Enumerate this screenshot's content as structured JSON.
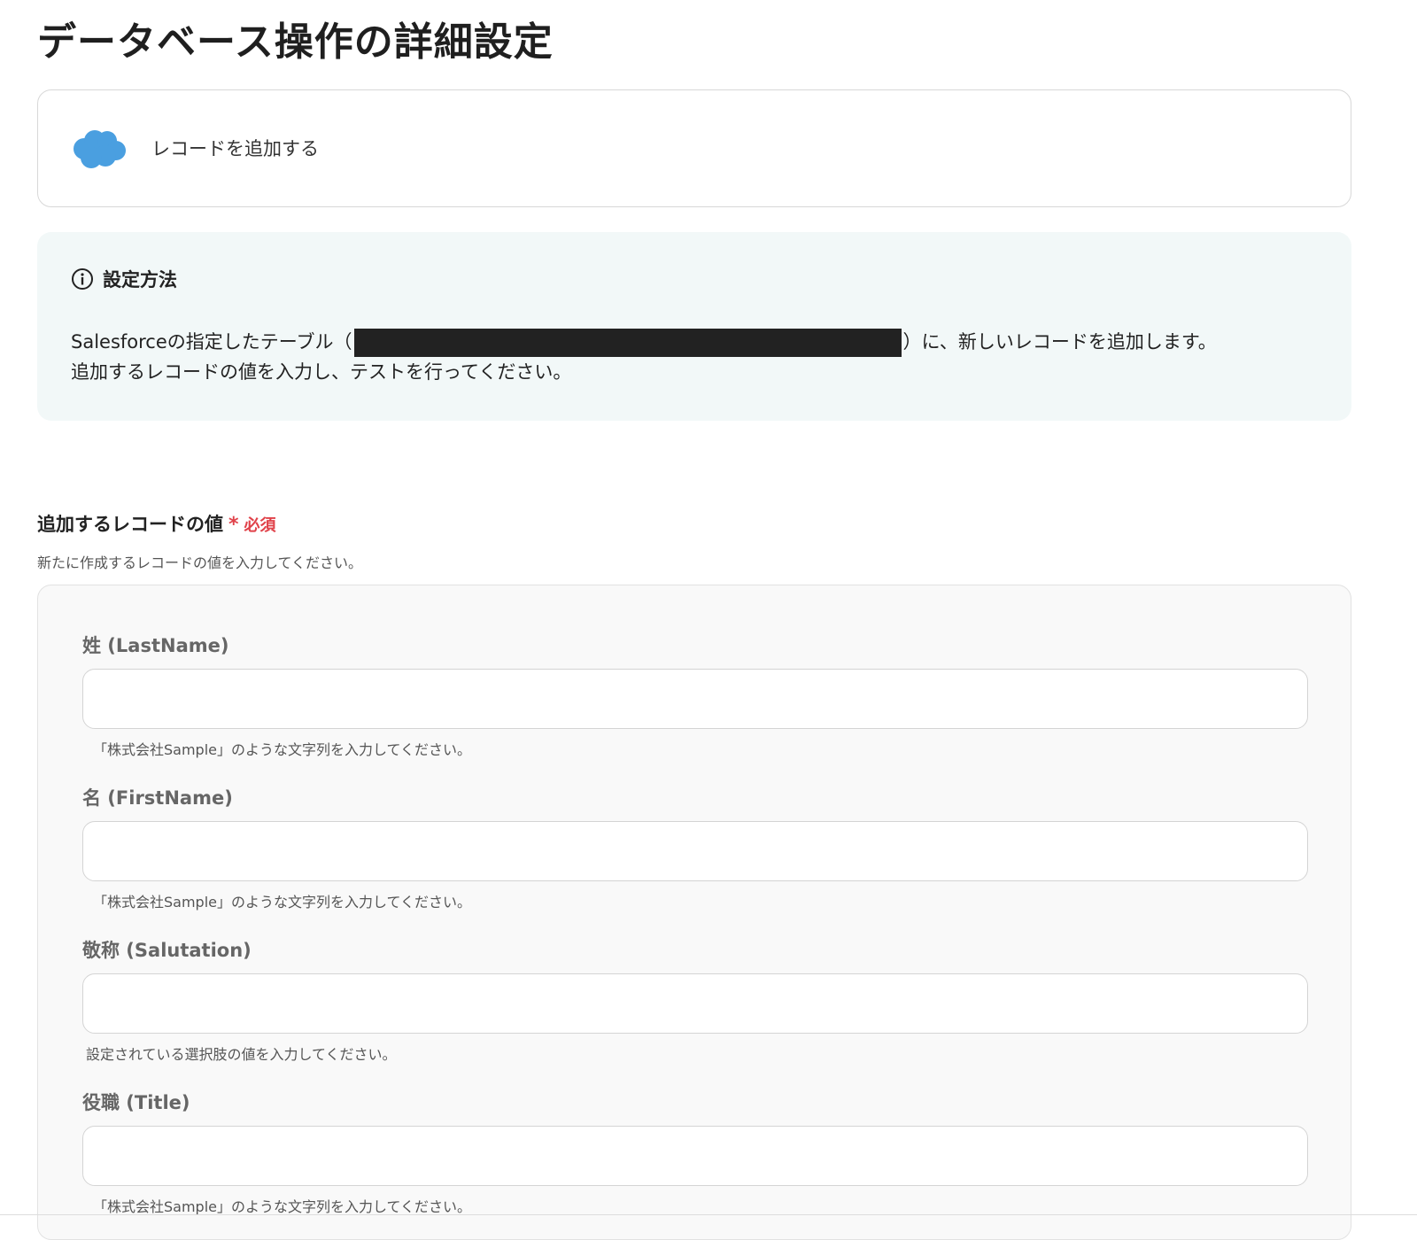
{
  "page": {
    "title": "データベース操作の詳細設定"
  },
  "action": {
    "app_icon": "salesforce-cloud-icon",
    "label": "レコードを追加する",
    "brand_color": "#4a9fe0"
  },
  "info": {
    "icon": "info-circle-icon",
    "heading": "設定方法",
    "line1_before": "Salesforceの指定したテーブル（",
    "line1_after": "）に、新しいレコードを追加します。",
    "line2": "追加するレコードの値を入力し、テストを行ってください。"
  },
  "section": {
    "title": "追加するレコードの値",
    "required_star": "*",
    "required_label": "必須",
    "description": "新たに作成するレコードの値を入力してください。",
    "required_color": "#e0424a"
  },
  "fields": [
    {
      "label": "姓 (LastName)",
      "value": "",
      "hint": "「株式会社Sample」のような文字列を入力してください。"
    },
    {
      "label": "名 (FirstName)",
      "value": "",
      "hint": "「株式会社Sample」のような文字列を入力してください。"
    },
    {
      "label": "敬称 (Salutation)",
      "value": "",
      "hint": "設定されている選択肢の値を入力してください。"
    },
    {
      "label": "役職 (Title)",
      "value": "",
      "hint": "「株式会社Sample」のような文字列を入力してください。"
    }
  ]
}
